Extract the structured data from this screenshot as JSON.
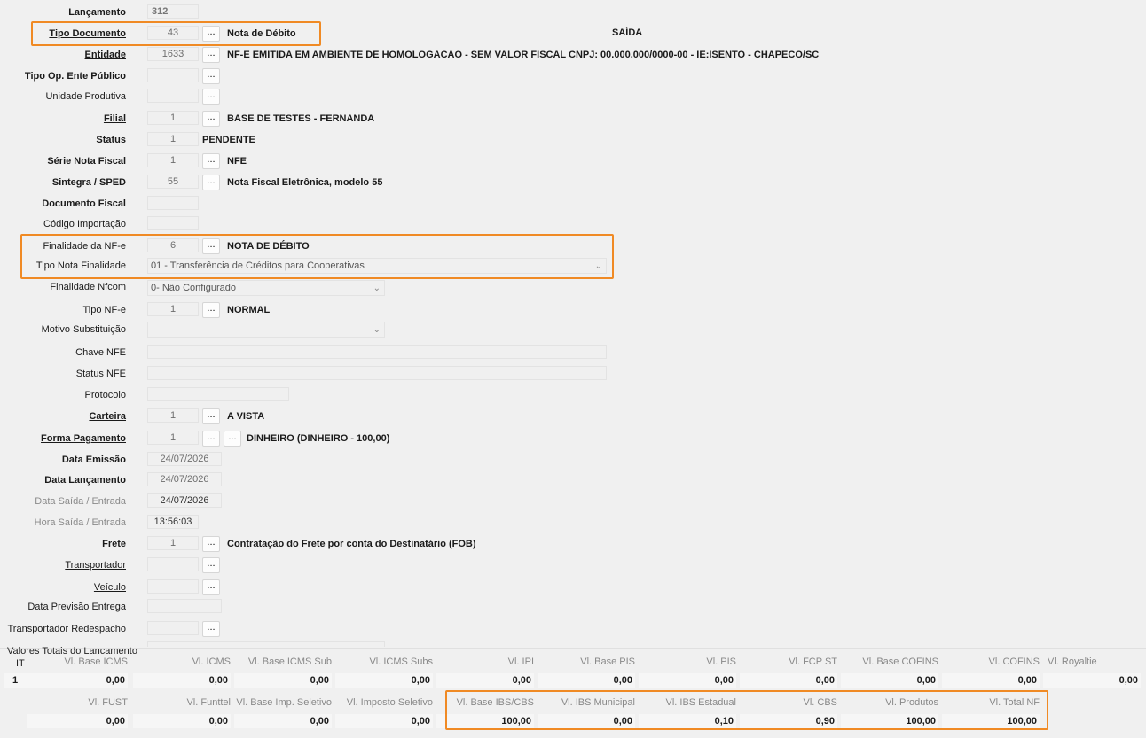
{
  "header": {
    "saida_label": "SAÍDA"
  },
  "fields": {
    "lancamento": {
      "label": "Lançamento",
      "value": "312"
    },
    "tipo_documento": {
      "label": "Tipo Documento",
      "value": "43",
      "desc": "Nota de Débito"
    },
    "entidade": {
      "label": "Entidade",
      "value": "1633",
      "desc": "NF-E EMITIDA EM AMBIENTE DE HOMOLOGACAO - SEM VALOR FISCAL CNPJ: 00.000.000/0000-00 - IE:ISENTO - CHAPECO/SC"
    },
    "tipo_op_ente_publico": {
      "label": "Tipo Op. Ente Público",
      "value": ""
    },
    "unidade_produtiva": {
      "label": "Unidade Produtiva",
      "value": ""
    },
    "filial": {
      "label": "Filial",
      "value": "1",
      "desc": "BASE DE TESTES - FERNANDA"
    },
    "status": {
      "label": "Status",
      "value": "1",
      "desc": "PENDENTE"
    },
    "serie_nota_fiscal": {
      "label": "Série Nota Fiscal",
      "value": "1",
      "desc": "NFE"
    },
    "sintegra_sped": {
      "label": "Sintegra / SPED",
      "value": "55",
      "desc": "Nota Fiscal Eletrônica, modelo 55"
    },
    "documento_fiscal": {
      "label": "Documento Fiscal",
      "value": ""
    },
    "codigo_importacao": {
      "label": "Código Importação",
      "value": ""
    },
    "finalidade_nfe": {
      "label": "Finalidade da NF-e",
      "value": "6",
      "desc": "NOTA DE DÉBITO"
    },
    "tipo_nota_finalidade": {
      "label": "Tipo Nota Finalidade",
      "value": "01 - Transferência de Créditos para Cooperativas"
    },
    "finalidade_nfcom": {
      "label": "Finalidade Nfcom",
      "value": "0- Não Configurado"
    },
    "tipo_nfe": {
      "label": "Tipo NF-e",
      "value": "1",
      "desc": "NORMAL"
    },
    "motivo_substituicao": {
      "label": "Motivo Substituição",
      "value": ""
    },
    "chave_nfe": {
      "label": "Chave NFE",
      "value": ""
    },
    "status_nfe": {
      "label": "Status NFE",
      "value": ""
    },
    "protocolo": {
      "label": "Protocolo",
      "value": ""
    },
    "carteira": {
      "label": "Carteira",
      "value": "1",
      "desc": "A VISTA"
    },
    "forma_pagamento": {
      "label": "Forma Pagamento",
      "value": "1",
      "desc": "DINHEIRO (DINHEIRO - 100,00)"
    },
    "data_emissao": {
      "label": "Data Emissão",
      "value": "24/07/2026"
    },
    "data_lancamento": {
      "label": "Data Lançamento",
      "value": "24/07/2026"
    },
    "data_saida_entrada": {
      "label": "Data Saída / Entrada",
      "value": "24/07/2026"
    },
    "hora_saida_entrada": {
      "label": "Hora Saída / Entrada",
      "value": "13:56:03"
    },
    "frete": {
      "label": "Frete",
      "value": "1",
      "desc": "Contratação do Frete por conta do Destinatário (FOB)"
    },
    "transportador": {
      "label": "Transportador",
      "value": ""
    },
    "veiculo": {
      "label": "Veículo",
      "value": ""
    },
    "data_previsao_entrega": {
      "label": "Data Previsão Entrega",
      "value": ""
    },
    "transportador_redespacho": {
      "label": "Transportador Redespacho",
      "value": ""
    }
  },
  "ellipsis": "...",
  "totals": {
    "section_title": "Valores Totais do Lancamento",
    "it_header": "IT",
    "it_value": "1",
    "row1_headers": [
      "Vl. Base ICMS",
      "Vl. ICMS",
      "Vl. Base ICMS Sub",
      "Vl. ICMS Subs",
      "Vl. IPI",
      "Vl. Base PIS",
      "Vl. PIS",
      "Vl. FCP ST",
      "Vl. Base COFINS",
      "Vl. COFINS",
      "Vl. Royaltie"
    ],
    "row1_values": [
      "0,00",
      "0,00",
      "0,00",
      "0,00",
      "0,00",
      "0,00",
      "0,00",
      "0,00",
      "0,00",
      "0,00",
      "0,00"
    ],
    "row2_headers": [
      "Vl. FUST",
      "Vl. Funttel",
      "Vl. Base Imp. Seletivo",
      "Vl. Imposto Seletivo",
      "Vl. Base IBS/CBS",
      "Vl. IBS Municipal",
      "Vl. IBS Estadual",
      "Vl. CBS",
      "Vl. Produtos",
      "Vl. Total NF"
    ],
    "row2_values": [
      "0,00",
      "0,00",
      "0,00",
      "0,00",
      "100,00",
      "0,00",
      "0,10",
      "0,90",
      "100,00",
      "100,00"
    ]
  },
  "colors": {
    "highlight": "#f08a24"
  }
}
